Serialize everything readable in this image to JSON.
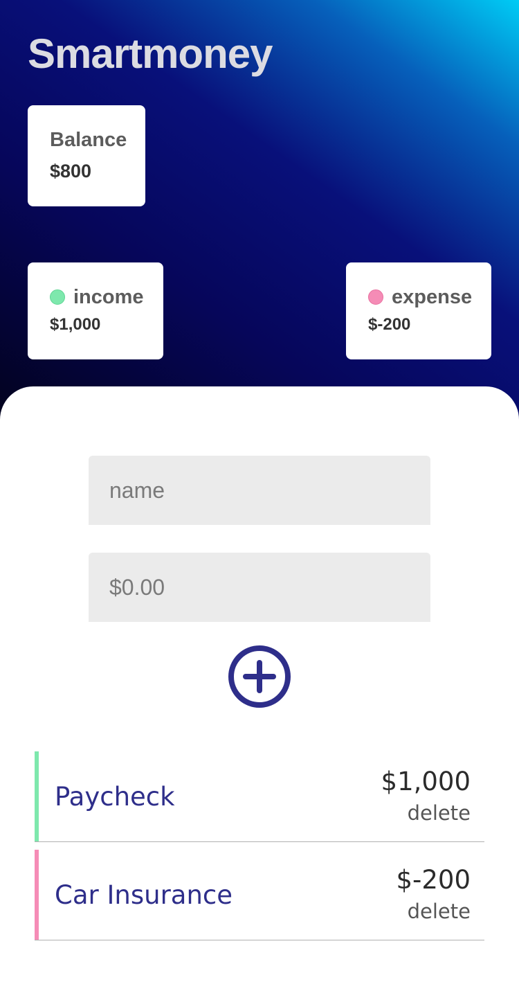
{
  "app": {
    "title": "Smartmoney"
  },
  "balance": {
    "label": "Balance",
    "value": "$800"
  },
  "income": {
    "label": "income",
    "value": "$1,000",
    "color": "#7ee8ad"
  },
  "expense": {
    "label": "expense",
    "value": "$-200",
    "color": "#f58cb6"
  },
  "form": {
    "name_placeholder": "name",
    "amount_placeholder": "$0.00",
    "add_icon": "plus-circle-icon",
    "accent_color": "#2e2e8a"
  },
  "transactions": [
    {
      "name": "Paycheck",
      "amount": "$1,000",
      "delete_label": "delete",
      "type": "income"
    },
    {
      "name": "Car Insurance",
      "amount": "$-200",
      "delete_label": "delete",
      "type": "expense"
    }
  ]
}
